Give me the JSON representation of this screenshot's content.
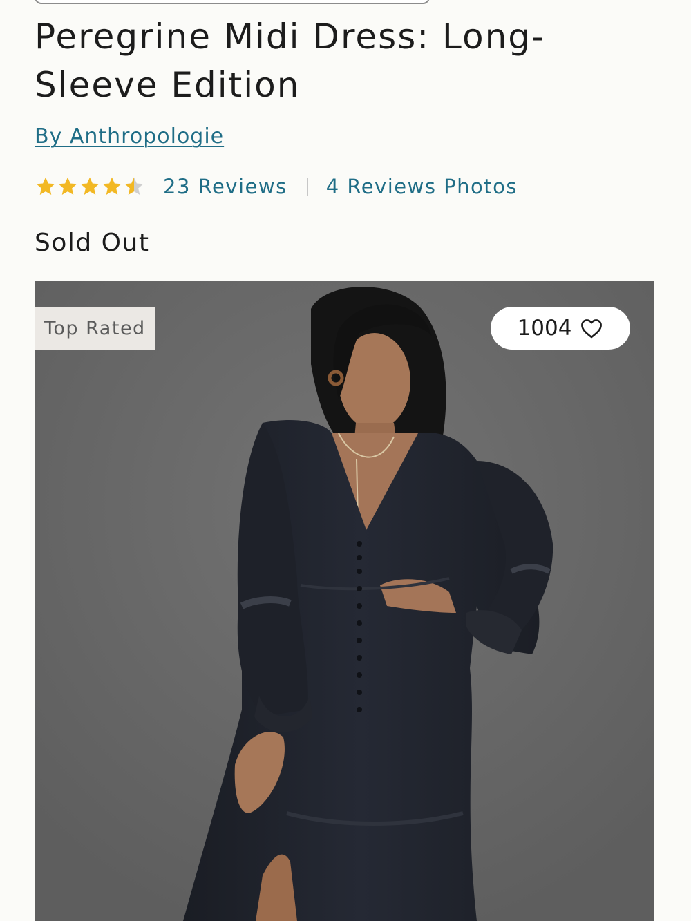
{
  "product": {
    "title": "Peregrine Midi Dress: Long-Sleeve Edition",
    "brand_link": "By Anthropologie",
    "rating": 4.5,
    "rating_max": 5,
    "reviews_link": "23 Reviews",
    "photos_link": "4 Reviews Photos",
    "status": "Sold Out"
  },
  "image": {
    "badge": "Top Rated",
    "favorites_count": "1004",
    "alt": "Model wearing black long-sleeve midi dress"
  },
  "icons": {
    "star": "star-icon",
    "favorite": "heart-icon"
  },
  "colors": {
    "link": "#1f6d86",
    "star": "#f2b824",
    "star_empty": "#cfcfcf",
    "page_bg": "#fbfbf8"
  }
}
